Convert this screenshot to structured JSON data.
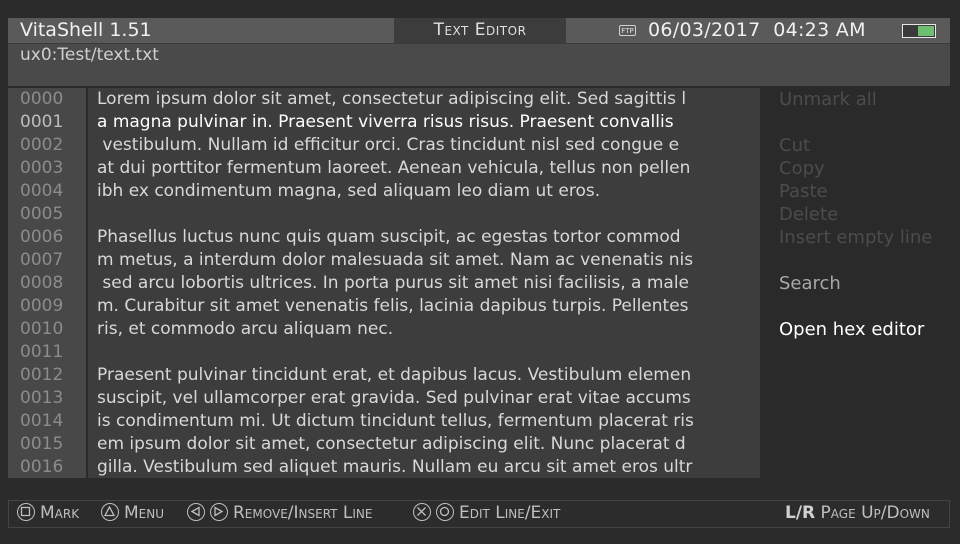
{
  "header": {
    "app_title": "VitaShell 1.51",
    "mode_title": "Text Editor",
    "ftp_icon_text": "FTP",
    "date": "06/03/2017",
    "time": "04:23 AM",
    "battery_level": 0.55
  },
  "path": "ux0:Test/text.txt",
  "editor": {
    "active_line": 1,
    "lines": [
      {
        "num": "0000",
        "text": "Lorem ipsum dolor sit amet, consectetur adipiscing elit. Sed sagittis l"
      },
      {
        "num": "0001",
        "text": "a magna pulvinar in. Praesent viverra risus risus. Praesent convallis"
      },
      {
        "num": "0002",
        "text": " vestibulum. Nullam id efficitur orci. Cras tincidunt nisl sed congue e"
      },
      {
        "num": "0003",
        "text": "at dui porttitor fermentum laoreet. Aenean vehicula, tellus non pellen"
      },
      {
        "num": "0004",
        "text": "ibh ex condimentum magna, sed aliquam leo diam ut eros."
      },
      {
        "num": "0005",
        "text": ""
      },
      {
        "num": "0006",
        "text": "Phasellus luctus nunc quis quam suscipit, ac egestas tortor commod"
      },
      {
        "num": "0007",
        "text": "m metus, a interdum dolor malesuada sit amet. Nam ac venenatis nis"
      },
      {
        "num": "0008",
        "text": " sed arcu lobortis ultrices. In porta purus sit amet nisi facilisis, a male"
      },
      {
        "num": "0009",
        "text": "m. Curabitur sit amet venenatis felis, lacinia dapibus turpis. Pellentes"
      },
      {
        "num": "0010",
        "text": "ris, et commodo arcu aliquam nec."
      },
      {
        "num": "0011",
        "text": ""
      },
      {
        "num": "0012",
        "text": "Praesent pulvinar tincidunt erat, et dapibus lacus. Vestibulum elemen"
      },
      {
        "num": "0013",
        "text": "suscipit, vel ullamcorper erat gravida. Sed pulvinar erat vitae accums"
      },
      {
        "num": "0014",
        "text": "is condimentum mi. Ut dictum tincidunt tellus, fermentum placerat ris"
      },
      {
        "num": "0015",
        "text": "em ipsum dolor sit amet, consectetur adipiscing elit. Nunc placerat d"
      },
      {
        "num": "0016",
        "text": "gilla. Vestibulum sed aliquet mauris. Nullam eu arcu sit amet eros ultr"
      }
    ]
  },
  "context_menu": {
    "items": [
      {
        "label": "Unmark all",
        "state": "disabled"
      },
      {
        "label": "Cut",
        "state": "disabled"
      },
      {
        "label": "Copy",
        "state": "disabled"
      },
      {
        "label": "Paste",
        "state": "disabled"
      },
      {
        "label": "Delete",
        "state": "disabled"
      },
      {
        "label": "Insert empty line",
        "state": "disabled"
      },
      {
        "label": "Search",
        "state": "enabled"
      },
      {
        "label": "Open hex editor",
        "state": "selected"
      }
    ]
  },
  "help_bar": {
    "mark": "Mark",
    "menu": "Menu",
    "remove_insert": "Remove/Insert Line",
    "edit_exit": "Edit Line/Exit",
    "lr_keys": "L/R",
    "page": "Page Up/Down"
  },
  "colors": {
    "background": "#2b2b2b",
    "status_bar": "#5a5a5a",
    "battery": "#6fbf73",
    "selected_menu": "#ffffff",
    "disabled_menu": "#4c4c4c"
  }
}
